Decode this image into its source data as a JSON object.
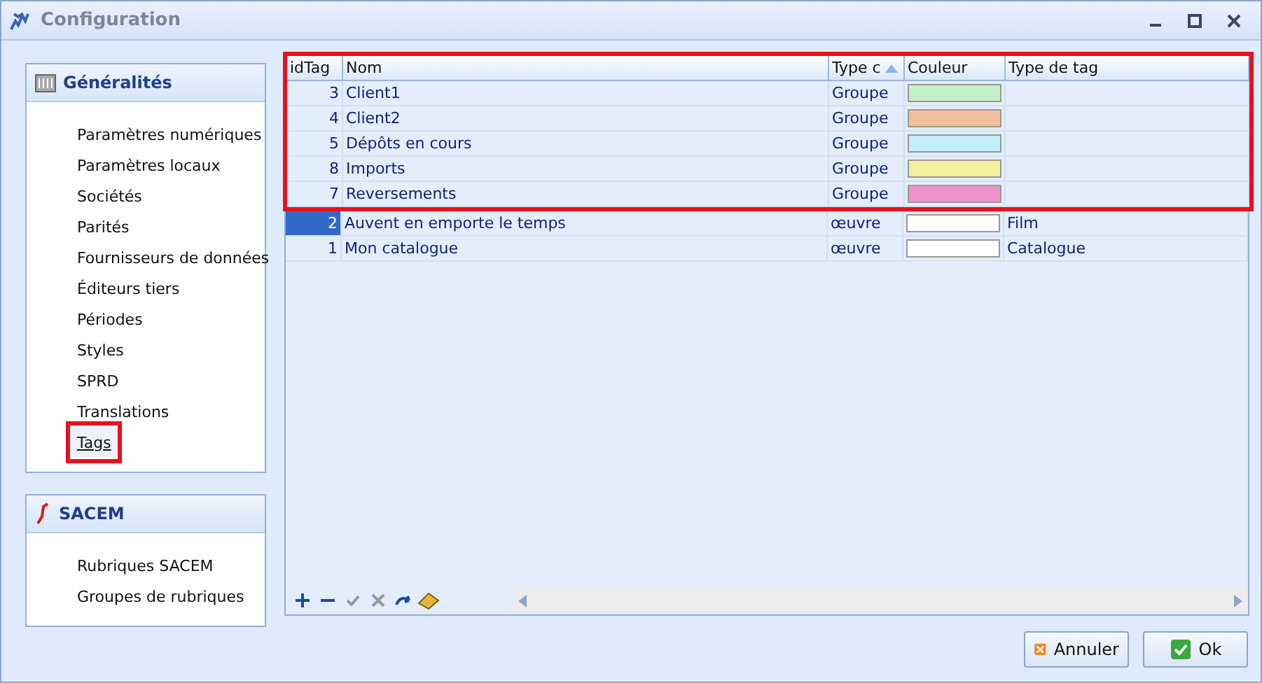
{
  "window": {
    "title": "Configuration"
  },
  "sidebar": {
    "groups": [
      {
        "kind": "general",
        "title": "Généralités",
        "items": [
          {
            "label": "Paramètres numériques",
            "selected": false,
            "highlighted": false
          },
          {
            "label": "Paramètres locaux",
            "selected": false,
            "highlighted": false
          },
          {
            "label": "Sociétés",
            "selected": false,
            "highlighted": false
          },
          {
            "label": "Parités",
            "selected": false,
            "highlighted": false
          },
          {
            "label": "Fournisseurs de données",
            "selected": false,
            "highlighted": false
          },
          {
            "label": "Éditeurs tiers",
            "selected": false,
            "highlighted": false
          },
          {
            "label": "Périodes",
            "selected": false,
            "highlighted": false
          },
          {
            "label": "Styles",
            "selected": false,
            "highlighted": false
          },
          {
            "label": "SPRD",
            "selected": false,
            "highlighted": false
          },
          {
            "label": "Translations",
            "selected": false,
            "highlighted": false
          },
          {
            "label": "Tags",
            "selected": true,
            "highlighted": true
          }
        ]
      },
      {
        "kind": "sacem",
        "title": "SACEM",
        "items": [
          {
            "label": "Rubriques SACEM",
            "selected": false,
            "highlighted": false
          },
          {
            "label": "Groupes de rubriques",
            "selected": false,
            "highlighted": false
          }
        ]
      }
    ]
  },
  "table": {
    "columns": [
      {
        "label": "idTag",
        "sorted": false
      },
      {
        "label": "Nom",
        "sorted": false
      },
      {
        "label": "Type c",
        "sorted": true
      },
      {
        "label": "Couleur",
        "sorted": false
      },
      {
        "label": "Type de tag",
        "sorted": false
      }
    ],
    "rows": [
      {
        "id": "3",
        "name": "Client1",
        "type": "Groupe",
        "color": "#c3f0cb",
        "tag_type": "",
        "highlighted": true,
        "selected": false
      },
      {
        "id": "4",
        "name": "Client2",
        "type": "Groupe",
        "color": "#f0c09a",
        "tag_type": "",
        "highlighted": true,
        "selected": false
      },
      {
        "id": "5",
        "name": "Dépôts en cours",
        "type": "Groupe",
        "color": "#c3eefc",
        "tag_type": "",
        "highlighted": true,
        "selected": false
      },
      {
        "id": "8",
        "name": "Imports",
        "type": "Groupe",
        "color": "#f3ef9c",
        "tag_type": "",
        "highlighted": true,
        "selected": false
      },
      {
        "id": "7",
        "name": "Reversements",
        "type": "Groupe",
        "color": "#f090cc",
        "tag_type": "",
        "highlighted": true,
        "selected": false
      },
      {
        "id": "2",
        "name": "Auvent en emporte le temps",
        "type": "œuvre",
        "color": "#ffffff",
        "tag_type": "Film",
        "highlighted": false,
        "selected": true
      },
      {
        "id": "1",
        "name": "Mon catalogue",
        "type": "œuvre",
        "color": "#ffffff",
        "tag_type": "Catalogue",
        "highlighted": false,
        "selected": false
      }
    ]
  },
  "buttons": [
    {
      "kind": "cancel",
      "label": "Annuler"
    },
    {
      "kind": "ok",
      "label": "Ok"
    }
  ]
}
